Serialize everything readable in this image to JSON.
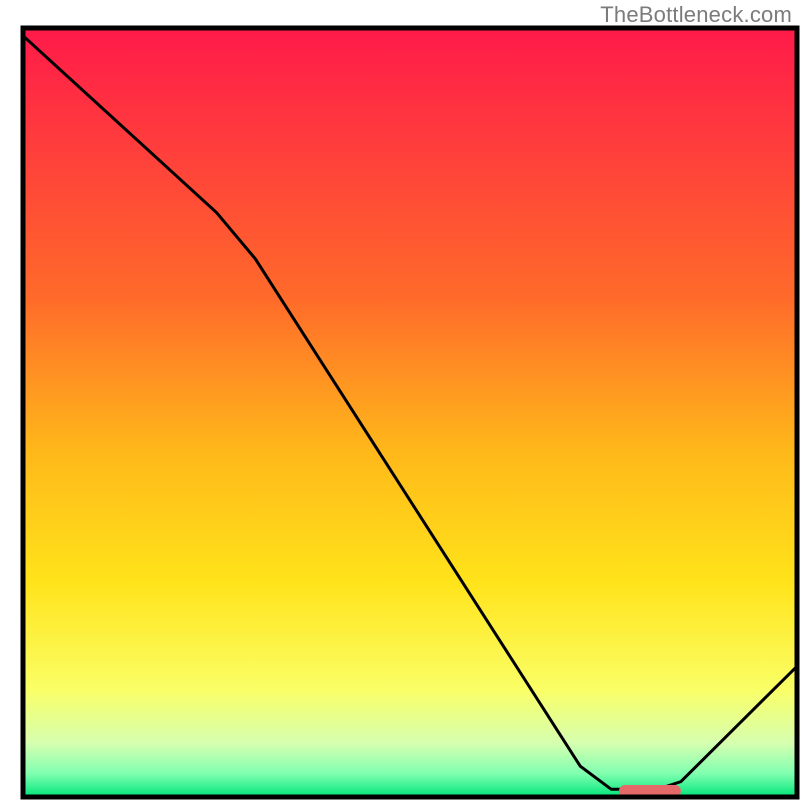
{
  "attribution": "TheBottleneck.com",
  "chart_data": {
    "type": "line",
    "title": "",
    "xlabel": "",
    "ylabel": "",
    "xlim": [
      0,
      100
    ],
    "ylim": [
      0,
      100
    ],
    "gradient_stops": [
      {
        "offset": 0,
        "color": "#ff1a4a"
      },
      {
        "offset": 35,
        "color": "#ff6a2a"
      },
      {
        "offset": 55,
        "color": "#ffb81a"
      },
      {
        "offset": 72,
        "color": "#ffe31a"
      },
      {
        "offset": 86,
        "color": "#faff66"
      },
      {
        "offset": 93,
        "color": "#d6ffb0"
      },
      {
        "offset": 97,
        "color": "#7fffb0"
      },
      {
        "offset": 100,
        "color": "#00e57a"
      }
    ],
    "curve": [
      {
        "x": 0,
        "y": 99
      },
      {
        "x": 25,
        "y": 76
      },
      {
        "x": 30,
        "y": 70
      },
      {
        "x": 72,
        "y": 4
      },
      {
        "x": 76,
        "y": 1
      },
      {
        "x": 82,
        "y": 1
      },
      {
        "x": 85,
        "y": 2
      },
      {
        "x": 100,
        "y": 17
      }
    ],
    "marker": {
      "x_from": 77,
      "x_to": 85,
      "y": 0,
      "color": "#e46a6a"
    },
    "frame_color": "#000000",
    "frame_thickness": 5,
    "curve_thickness": 3
  }
}
